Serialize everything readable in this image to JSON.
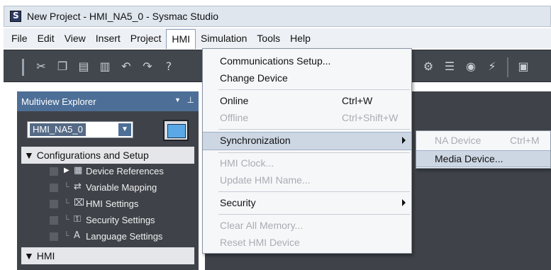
{
  "window": {
    "title": "New Project - HMI_NA5_0 - Sysmac Studio"
  },
  "menubar": {
    "items": [
      "File",
      "Edit",
      "View",
      "Insert",
      "Project",
      "HMI",
      "Simulation",
      "Tools",
      "Help"
    ],
    "active": "HMI"
  },
  "toolbar": {
    "icons": [
      "cut-icon",
      "copy-icon",
      "paste-icon",
      "delete-icon",
      "undo-icon",
      "redo-icon",
      "help-icon",
      "settings-icon",
      "list-icon",
      "record-icon",
      "transfer-icon",
      "build-icon"
    ]
  },
  "explorer": {
    "title": "Multiview Explorer",
    "device": "HMI_NA5_0",
    "sections": {
      "config": "▼ Configurations and Setup",
      "hmi": "▼ HMI"
    },
    "items": [
      {
        "label": "Device References",
        "icon": "device-references-icon"
      },
      {
        "label": "Variable Mapping",
        "icon": "variable-mapping-icon"
      },
      {
        "label": "HMI Settings",
        "icon": "hmi-settings-icon"
      },
      {
        "label": "Security Settings",
        "icon": "security-settings-icon"
      },
      {
        "label": "Language Settings",
        "icon": "language-settings-icon"
      }
    ]
  },
  "hmi_menu": {
    "items": [
      {
        "label": "Communications Setup...",
        "shortcut": "",
        "enabled": true
      },
      {
        "label": "Change Device",
        "shortcut": "",
        "enabled": true
      },
      {
        "label": "Online",
        "shortcut": "Ctrl+W",
        "enabled": true
      },
      {
        "label": "Offline",
        "shortcut": "Ctrl+Shift+W",
        "enabled": false
      },
      {
        "label": "Synchronization",
        "shortcut": "",
        "enabled": true,
        "submenu": true,
        "highlighted": true
      },
      {
        "label": "HMI Clock...",
        "shortcut": "",
        "enabled": false
      },
      {
        "label": "Update HMI Name...",
        "shortcut": "",
        "enabled": false
      },
      {
        "label": "Security",
        "shortcut": "",
        "enabled": true,
        "submenu": true
      },
      {
        "label": "Clear All Memory...",
        "shortcut": "",
        "enabled": false
      },
      {
        "label": "Reset HMI Device",
        "shortcut": "",
        "enabled": false
      }
    ]
  },
  "sync_submenu": {
    "items": [
      {
        "label": "NA Device",
        "shortcut": "Ctrl+M",
        "enabled": false
      },
      {
        "label": "Media Device...",
        "shortcut": "",
        "enabled": true,
        "highlighted": true
      }
    ]
  },
  "colors": {
    "panel_bg": "#3f4349",
    "panel_header": "#4d6f97",
    "menu_highlight": "#cdd7e4",
    "disabled_text": "#a8adb3"
  }
}
